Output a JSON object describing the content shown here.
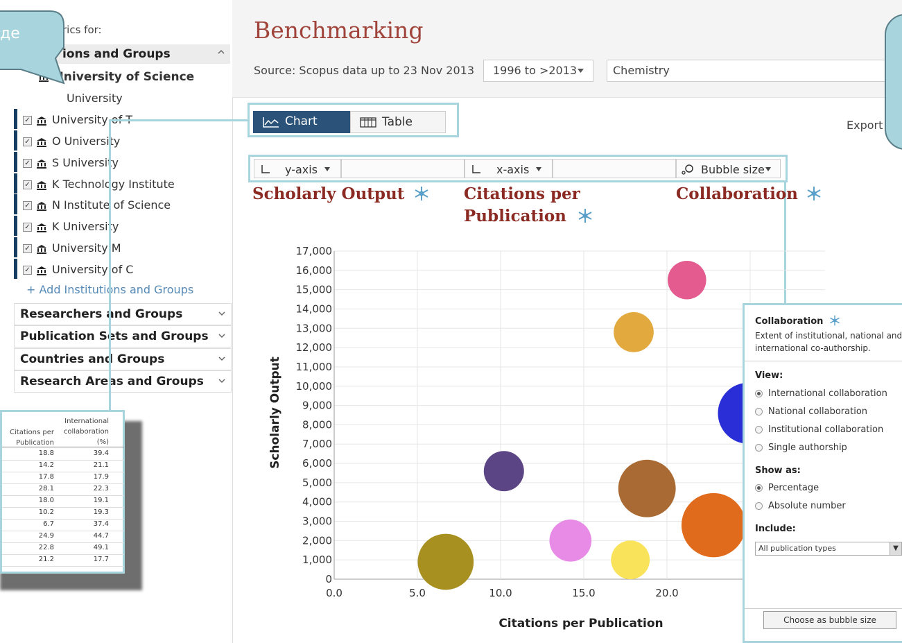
{
  "sidebar": {
    "title": "rics for:",
    "institutions_header": "ions and Groups",
    "institutions": [
      {
        "name": "University of Science",
        "bold": true
      },
      {
        "name": "University"
      },
      {
        "name": "University of T"
      },
      {
        "name": "O University"
      },
      {
        "name": "S University"
      },
      {
        "name": "K Technology Institute"
      },
      {
        "name": "N Institute of Science"
      },
      {
        "name": "K University"
      },
      {
        "name": "University M"
      },
      {
        "name": "University of C"
      }
    ],
    "add_link": "+ Add Institutions and Groups",
    "categories": [
      "Researchers and Groups",
      "Publication Sets and Groups",
      "Countries and Groups",
      "Research Areas and Groups"
    ]
  },
  "header": {
    "title": "Benchmarking",
    "source": "Source: Scopus data up to 23 Nov 2013",
    "year_range": "1996 to >2013",
    "subject": "Chemistry",
    "export": "Export"
  },
  "view_tabs": {
    "chart": "Chart",
    "table": "Table"
  },
  "axis_selectors": {
    "y": "y-axis",
    "x": "x-axis",
    "bubble": "Bubble size"
  },
  "metrics": {
    "y": "Scholarly Output",
    "x_line1": "Citations per",
    "x_line2": "Publication",
    "bubble": "Collaboration"
  },
  "chart_data": {
    "type": "scatter",
    "xlabel": "Citations per Publication",
    "ylabel": "Scholarly Output",
    "xlim": [
      0,
      22
    ],
    "ylim": [
      0,
      17000
    ],
    "x_ticks": [
      "0.0",
      "5.0",
      "10.0",
      "15.0",
      "20.0",
      "2"
    ],
    "y_ticks": [
      "0",
      "1,000",
      "2,000",
      "3,000",
      "4,000",
      "5,000",
      "6,000",
      "7,000",
      "8,000",
      "9,000",
      "10,000",
      "11,000",
      "12,000",
      "13,000",
      "14,000",
      "15,000",
      "16,000",
      "17,000"
    ],
    "grid": true,
    "points": [
      {
        "x": 6.7,
        "y": 900,
        "size": 37.4,
        "color": "#a89020"
      },
      {
        "x": 10.2,
        "y": 5600,
        "size": 19.3,
        "color": "#5c4585"
      },
      {
        "x": 14.2,
        "y": 2000,
        "size": 21.1,
        "color": "#e88be6"
      },
      {
        "x": 17.8,
        "y": 1000,
        "size": 17.9,
        "color": "#f9e35b"
      },
      {
        "x": 18.0,
        "y": 12800,
        "size": 19.1,
        "color": "#e2aa3e"
      },
      {
        "x": 18.8,
        "y": 4700,
        "size": 39.4,
        "color": "#a96a33"
      },
      {
        "x": 21.2,
        "y": 15500,
        "size": 17.7,
        "color": "#e35b8f"
      },
      {
        "x": 22.8,
        "y": 2800,
        "size": 49.1,
        "color": "#e06b1d"
      },
      {
        "x": 24.9,
        "y": 8600,
        "size": 44.7,
        "color": "#2a2ed6"
      }
    ]
  },
  "collab_popup": {
    "title": "Collaboration",
    "description": "Extent of institutional, national and international co-authorship.",
    "view_label": "View:",
    "view_options": [
      "International collaboration",
      "National collaboration",
      "Institutional collaboration",
      "Single authorship"
    ],
    "show_label": "Show as:",
    "show_options": [
      "Percentage",
      "Absolute number"
    ],
    "include_label": "Include:",
    "include_value": "All publication types",
    "choose_button": "Choose as bubble size"
  },
  "callout_tl": {
    "text": "де"
  },
  "overlay_table": {
    "col1_header": [
      "Citations per",
      "Publication"
    ],
    "col2_header": [
      "International",
      "collaboration",
      "(%)"
    ],
    "rows": [
      [
        "18.8",
        "39.4"
      ],
      [
        "14.2",
        "21.1"
      ],
      [
        "17.8",
        "17.9"
      ],
      [
        "28.1",
        "22.3"
      ],
      [
        "18.0",
        "19.1"
      ],
      [
        "10.2",
        "19.3"
      ],
      [
        "6.7",
        "37.4"
      ],
      [
        "24.9",
        "44.7"
      ],
      [
        "22.8",
        "49.1"
      ],
      [
        "21.2",
        "17.7"
      ]
    ]
  },
  "colors": {
    "accent": "#2b5379",
    "callout": "#a8d4dd",
    "metric_title": "#8b2a22",
    "page_title": "#a0433a"
  }
}
